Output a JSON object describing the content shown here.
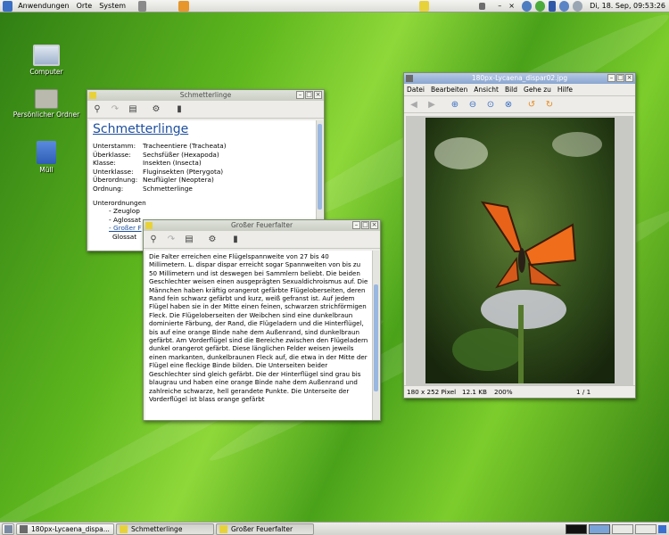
{
  "top_panel": {
    "menus": [
      "Anwendungen",
      "Orte",
      "System"
    ],
    "datetime": "Di, 18. Sep, 09:53:26",
    "separator_glyph": "–",
    "close_glyph": "×"
  },
  "desktop": {
    "icons": [
      {
        "label": "Computer"
      },
      {
        "label": "Persönlicher Ordner"
      },
      {
        "label": "Müll"
      }
    ]
  },
  "win_schmetterlinge": {
    "title": "Schmetterlinge",
    "heading": "Schmetterlinge",
    "taxonomy": [
      {
        "key": "Unterstamm:",
        "value": "Tracheentiere (Tracheata)"
      },
      {
        "key": "Überklasse:",
        "value": "Sechsfüßer (Hexapoda)"
      },
      {
        "key": "Klasse:",
        "value": "Insekten (Insecta)"
      },
      {
        "key": "Unterklasse:",
        "value": "Fluginsekten (Pterygota)"
      },
      {
        "key": "Überordnung:",
        "value": "Neuflügler (Neoptera)"
      },
      {
        "key": "Ordnung:",
        "value": "Schmetterlinge"
      }
    ],
    "sub_heading": "Unterordnungen",
    "sub_items": [
      "- Zeuglop",
      "- Aglossat",
      "- Großer F",
      "Glossat"
    ]
  },
  "win_feuerfalter": {
    "title": "Großer Feuerfalter",
    "text": "Die Falter erreichen eine Flügelspannweite von 27 bis 40 Millimetern. L. dispar dispar erreicht sogar Spannweiten von bis zu 50 Millimetern und ist deswegen bei Sammlern beliebt. Die beiden Geschlechter weisen einen ausgeprägten Sexualdichroismus auf. Die Männchen haben kräftig orangerot gefärbte Flügeloberseiten, deren Rand fein schwarz gefärbt und kurz, weiß gefranst ist. Auf jedem Flügel haben sie in der Mitte einen feinen, schwarzen strichförmigen Fleck. Die Flügeloberseiten der Weibchen sind eine dunkelbraun dominierte Färbung, der Rand, die Flügeladern und die Hinterflügel, bis auf eine orange Binde nahe dem Außenrand, sind dunkelbraun gefärbt. Am Vorderflügel sind die Bereiche zwischen den Flügeladern dunkel orangerot gefärbt. Diese länglichen Felder weisen jeweils einen markanten, dunkelbraunen Fleck auf, die etwa in der Mitte der Flügel eine fleckige Binde bilden. Die Unterseiten beider Geschlechter sind gleich gefärbt. Die der Hinterflügel sind grau bis blaugrau und haben eine orange Binde nahe dem Außenrand und zahlreiche schwarze, hell gerandete Punkte. Die Unterseite der Vorderflügel ist blass orange gefärbt"
  },
  "win_viewer": {
    "title": "180px-Lycaena_dispar02.jpg",
    "menus": [
      "Datei",
      "Bearbeiten",
      "Ansicht",
      "Bild",
      "Gehe zu",
      "Hilfe"
    ],
    "status_size": "180 x 252 Pixel",
    "status_filesize": "12.1 KB",
    "status_zoom": "200%",
    "status_page": "1 / 1"
  },
  "taskbar": {
    "tasks": [
      {
        "label": "180px-Lycaena_dispa..."
      },
      {
        "label": "Schmetterlinge"
      },
      {
        "label": "Großer Feuerfalter"
      }
    ]
  },
  "window_buttons": {
    "minimize": "–",
    "maximize": "□",
    "close": "×"
  }
}
